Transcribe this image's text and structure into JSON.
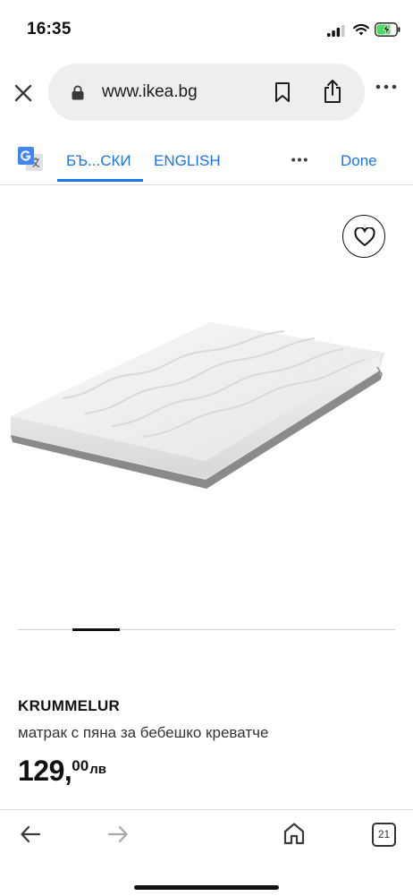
{
  "status_bar": {
    "time": "16:35"
  },
  "browser": {
    "url": "www.ikea.bg"
  },
  "translate_bar": {
    "source_language_label": "БЪ...СКИ",
    "target_language_label": "ENGLISH",
    "done_label": "Done"
  },
  "gallery": {
    "current_index": 2,
    "image_count": 7
  },
  "product": {
    "name": "KRUMMELUR",
    "description": "матрак с пяна за бебешко креватче",
    "price_integer": "129,",
    "price_decimal": "00",
    "currency": "лв"
  },
  "bottom_bar": {
    "tab_count": "21"
  },
  "colors": {
    "accent": "#1a73e8",
    "text": "#111111",
    "url_pill": "#eeeeef",
    "battery_charge": "#4cd964"
  }
}
